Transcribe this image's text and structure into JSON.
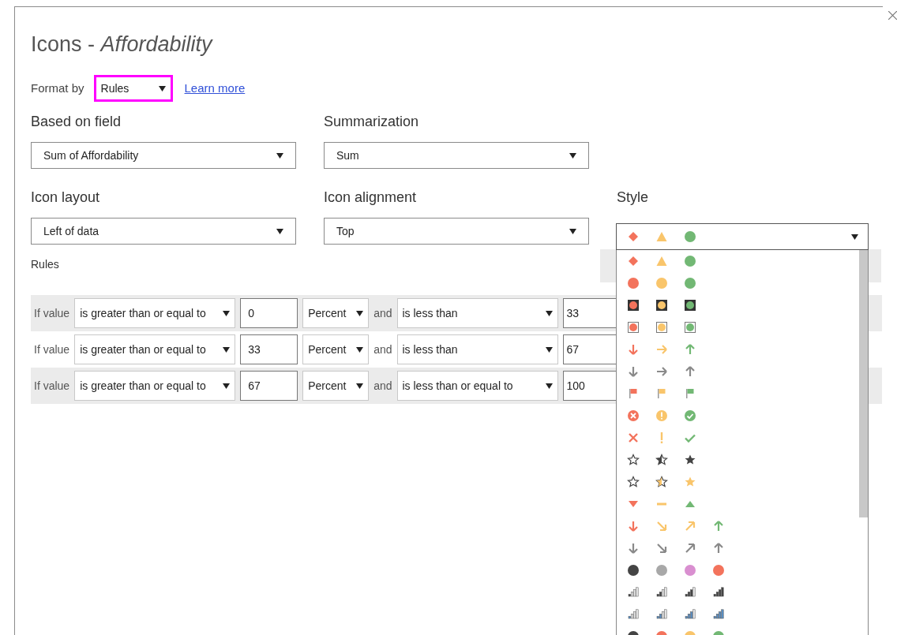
{
  "dialog": {
    "title": "Icons - *Affordability*"
  },
  "format_by": {
    "label": "Format by",
    "value": "Rules",
    "link": "Learn more"
  },
  "fields": [
    {
      "label": "Based on field",
      "value": "Sum of Affordability"
    },
    {
      "label": "Summarization",
      "value": "Sum"
    },
    {
      "label": "Icon layout",
      "value": "Left of data"
    },
    {
      "label": "Icon alignment",
      "value": "Top"
    }
  ],
  "style": {
    "label": "Style",
    "value": {
      "kind": "shapes"
    },
    "expanded": true,
    "options": [
      {
        "kind": "shapes"
      },
      {
        "kind": "circles"
      },
      {
        "kind": "lights-dark"
      },
      {
        "kind": "lights-framed"
      },
      {
        "kind": "arrows-color"
      },
      {
        "kind": "arrows-gray"
      },
      {
        "kind": "flags"
      },
      {
        "kind": "symbols-circled"
      },
      {
        "kind": "symbols"
      },
      {
        "kind": "stars-gray"
      },
      {
        "kind": "stars-gold"
      },
      {
        "kind": "triangles"
      },
      {
        "kind": "arrows4-color"
      },
      {
        "kind": "arrows4-gray"
      },
      {
        "kind": "circles4-mixed"
      },
      {
        "kind": "bars-gray"
      },
      {
        "kind": "bars-blue"
      },
      {
        "kind": "circles4"
      }
    ]
  },
  "rules": {
    "label": "Rules",
    "rows": [
      {
        "prefix": "If value",
        "operator": "is greater than or equal to",
        "value": "0",
        "unit": "Percent",
        "joiner": "and",
        "operator2": "is less than",
        "value2": "33"
      },
      {
        "prefix": "If value",
        "operator": "is greater than or equal to",
        "value": "33",
        "unit": "Percent",
        "joiner": "and",
        "operator2": "is less than",
        "value2": "67"
      },
      {
        "prefix": "If value",
        "operator": "is greater than or equal to",
        "value": "67",
        "unit": "Percent",
        "joiner": "and",
        "operator2": "is less than or equal to",
        "value2": "100"
      }
    ]
  }
}
